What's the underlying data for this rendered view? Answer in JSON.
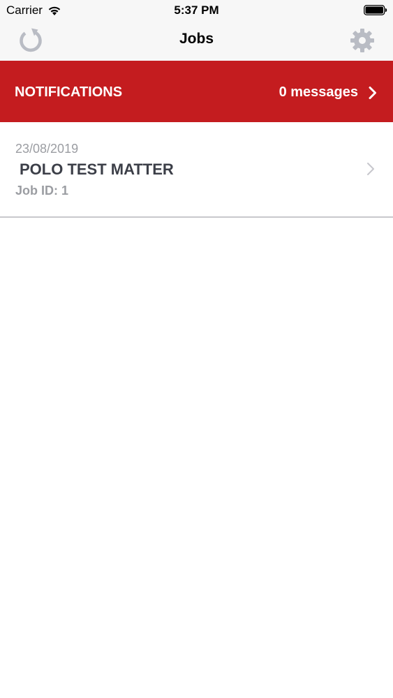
{
  "status_bar": {
    "carrier": "Carrier",
    "time": "5:37 PM"
  },
  "nav": {
    "title": "Jobs",
    "left_icon": "refresh-icon",
    "right_icon": "gear-icon"
  },
  "notifications": {
    "label": "NOTIFICATIONS",
    "count_text": "0 messages",
    "background_color": "#c41c1f"
  },
  "jobs": [
    {
      "date": "23/08/2019",
      "title": "POLO TEST MATTER",
      "job_id": "Job ID: 1"
    }
  ]
}
